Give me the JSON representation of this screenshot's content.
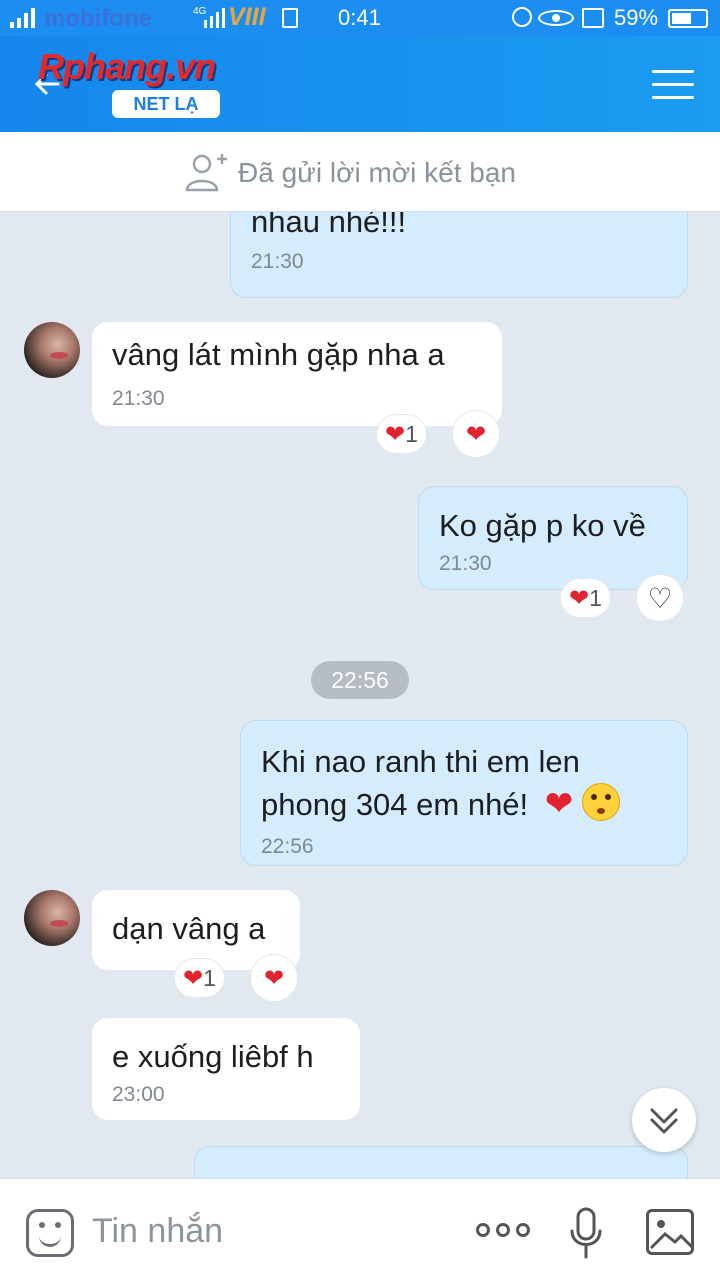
{
  "status_bar": {
    "carrier_left": "mobifone",
    "network_type": "4G",
    "carrier_right": "VIII",
    "time": "0:41",
    "battery_percent": "59%",
    "battery_level": 0.59
  },
  "header": {
    "logo_brand": "Rphang.vn",
    "logo_sub": "NET LẠ",
    "back_icon": "back-arrow-icon",
    "menu_icon": "hamburger-menu-icon"
  },
  "friend_request": {
    "label": "Đã gửi lời mời kết bạn",
    "icon": "user-plus-icon"
  },
  "messages": [
    {
      "direction": "out",
      "text": "nhau nhé!!!",
      "time": "21:30"
    },
    {
      "direction": "in",
      "text": "vâng lát mình gặp nha a",
      "time": "21:30",
      "reaction_count": "1"
    },
    {
      "direction": "out",
      "text": "Ko gặp p ko về",
      "time": "21:30",
      "reaction_count": "1"
    },
    {
      "direction": "out",
      "text": "Khi nao ranh thi em len\nphong 304 em nhé!",
      "time": "22:56"
    },
    {
      "direction": "in",
      "text": "dạn vâng a",
      "reaction_count": "1"
    },
    {
      "direction": "in",
      "text": "e xuống liêbf h",
      "time": "23:00"
    }
  ],
  "date_divider": "22:56",
  "colors": {
    "header_blue": "#1a8ef0",
    "outgoing_bubble": "#d4ecfd",
    "incoming_bubble": "#ffffff",
    "heart_red": "#e0232f",
    "chat_background": "#e1e8f0"
  },
  "input_bar": {
    "placeholder": "Tin nhắn",
    "icons": [
      "sticker-icon",
      "more-icon",
      "mic-icon",
      "image-icon"
    ]
  }
}
